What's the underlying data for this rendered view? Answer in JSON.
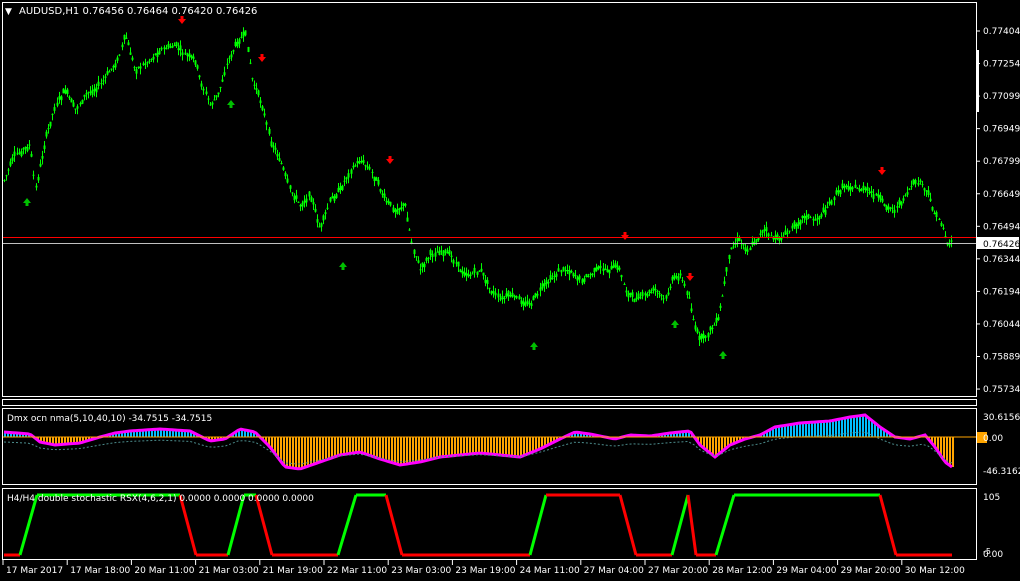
{
  "main_chart": {
    "symbol_info": "AUDUSD,H1  0.76456 0.76464 0.76420 0.76426",
    "price_labels": [
      "0.77404",
      "0.77254",
      "0.77099",
      "0.76949",
      "0.76799",
      "0.76649",
      "0.76494",
      "0.76344",
      "0.76194",
      "0.76044",
      "0.75889",
      "0.75734"
    ],
    "current_price": "0.76426",
    "bid_line_price": "0.76426",
    "colors": {
      "bull_bar": "#00ff00",
      "up_arrow": "#00c000",
      "down_arrow": "#ff0000",
      "grid": "#000000",
      "axis": "#ffffff",
      "red_line": "#ff0000",
      "gray_line": "#c0c0c0"
    }
  },
  "indicator1": {
    "title": "Dmx ocn nma(5,10,40,10) -34.7515 -34.7515",
    "scale_labels": [
      "30.6156",
      "0.00",
      "-46.3162"
    ],
    "colors": {
      "positive": "#00bfff",
      "negative": "#ffa500",
      "line": "#ff00ff",
      "band": "#4c8c8c"
    }
  },
  "indicator2": {
    "title": "H4/H4 double stochastic RSX(4,6,2,1) 0.0000 0.0000 0.0000 0.0000",
    "scale_labels": [
      "105",
      "0.00",
      "-5"
    ],
    "colors": {
      "up": "#00ff00",
      "down": "#ff0000"
    }
  },
  "time_axis": [
    "17 Mar 2017",
    "17 Mar 18:00",
    "20 Mar 11:00",
    "21 Mar 03:00",
    "21 Mar 19:00",
    "22 Mar 11:00",
    "23 Mar 03:00",
    "23 Mar 19:00",
    "24 Mar 11:00",
    "27 Mar 04:00",
    "27 Mar 20:00",
    "28 Mar 12:00",
    "29 Mar 04:00",
    "29 Mar 20:00",
    "30 Mar 12:00"
  ]
}
